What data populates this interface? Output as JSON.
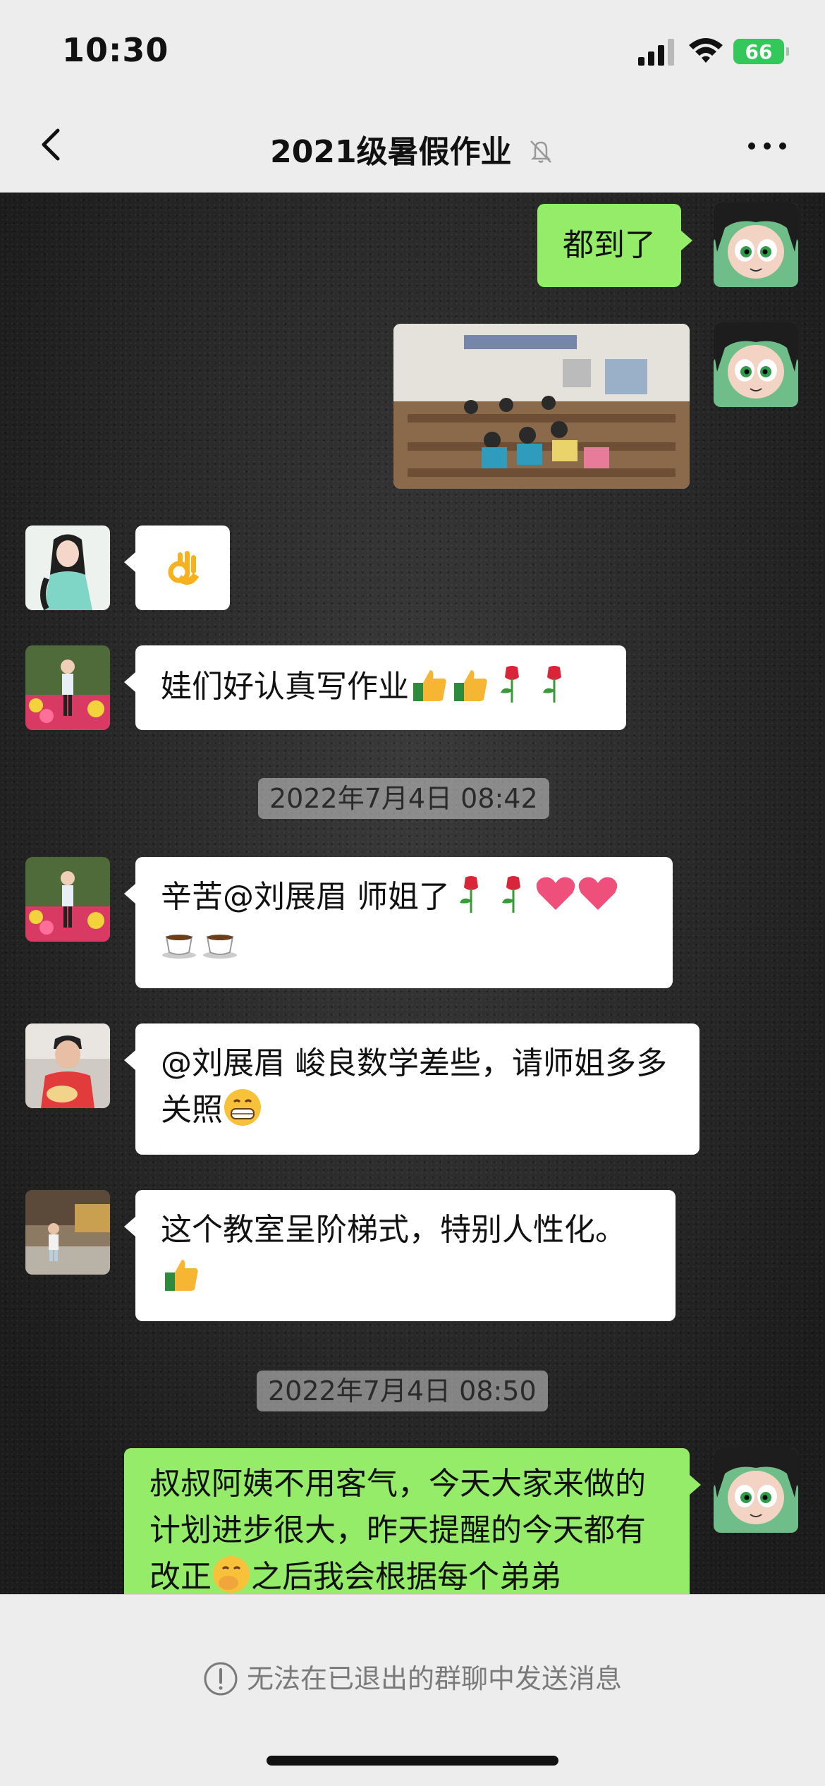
{
  "status_bar": {
    "time": "10:30",
    "battery": "66"
  },
  "nav": {
    "title": "2021级暑假作业"
  },
  "messages": {
    "m1": {
      "text": "都到了"
    },
    "m5_a": "辛苦@刘展眉 师姐了",
    "m6": "@刘展眉 峻良数学差些，请师姐多多关照",
    "m7": "这个教室呈阶梯式，特别人性化。",
    "m8_a": "叔叔阿姨不用客气，今天大家来做的计划进步很大，昨天提醒的今天都有改正",
    "m8_b": "之后我会根据每个弟弟",
    "m4": "娃们好认真写作业"
  },
  "timestamps": [
    "2022年7月4日 08:42",
    "2022年7月4日 08:50"
  ],
  "bottom": {
    "notice": "无法在已退出的群聊中发送消息"
  },
  "icons": [
    "back-icon",
    "mute-bell-icon",
    "more-icon",
    "signal-icon",
    "wifi-icon",
    "battery-icon",
    "info-icon"
  ],
  "colors": {
    "self_bubble": "#95ec69",
    "other_bubble": "#ffffff",
    "battery": "#34c759"
  }
}
